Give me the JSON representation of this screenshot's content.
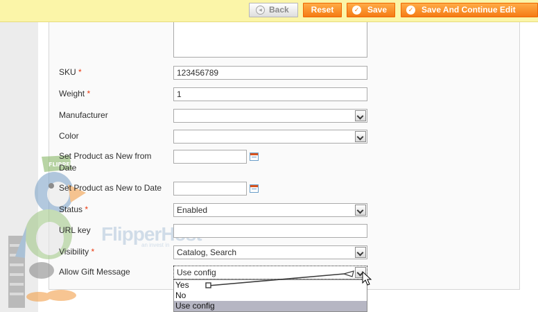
{
  "toolbar": {
    "back_label": "Back",
    "reset_label": "Reset",
    "save_label": "Save",
    "save_continue_label": "Save And Continue Edit"
  },
  "watermark": {
    "brand_text": "FlipperHost",
    "sub_text": "an invest in",
    "mascot_label": "FLIPPER"
  },
  "form": {
    "sku": {
      "label": "SKU",
      "required": "*",
      "value": "123456789"
    },
    "weight": {
      "label": "Weight",
      "required": "*",
      "value": "1"
    },
    "manufacturer": {
      "label": "Manufacturer",
      "value": ""
    },
    "color": {
      "label": "Color",
      "value": ""
    },
    "new_from": {
      "label": "Set Product as New from Date",
      "value": ""
    },
    "new_to": {
      "label": "Set Product as New to Date",
      "value": ""
    },
    "status": {
      "label": "Status",
      "required": "*",
      "value": "Enabled"
    },
    "url_key": {
      "label": "URL key",
      "value": ""
    },
    "visibility": {
      "label": "Visibility",
      "required": "*",
      "value": "Catalog, Search"
    },
    "gift_message": {
      "label": "Allow Gift Message",
      "value": "Use config",
      "options": [
        "Yes",
        "No",
        "Use config"
      ]
    }
  },
  "colors": {
    "toolbar_bg": "#fbf5a8",
    "button_orange": "#f57b14",
    "required_asterisk": "#eb340a",
    "selected_option": "#b6b6c3"
  },
  "icons": {
    "back": "back-arrow-icon",
    "save": "check-circle-icon",
    "calendar": "calendar-icon",
    "cursor": "mouse-pointer-icon"
  }
}
